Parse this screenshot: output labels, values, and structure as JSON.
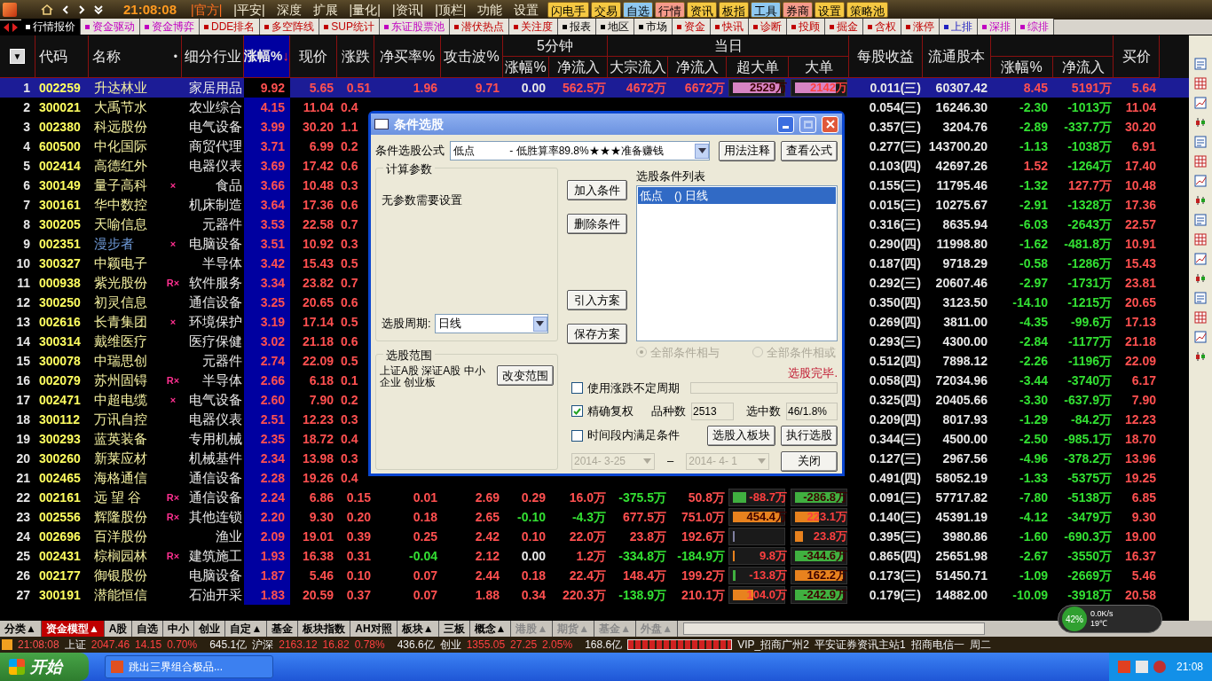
{
  "top_bar": {
    "time": "21:08:08",
    "menus": [
      "|官方|",
      "|平安|",
      "深度",
      "扩展",
      "|量化|",
      "|资讯|",
      "|顶栏|",
      "功能",
      "设置"
    ],
    "buttons": [
      {
        "label": "闪电手",
        "color": "#f5c842"
      },
      {
        "label": "交易",
        "color": "#f5c842"
      },
      {
        "label": "自选",
        "color": "#8ec8f0"
      },
      {
        "label": "行情",
        "color": "#f59a8a"
      },
      {
        "label": "资讯",
        "color": "#f5c842"
      },
      {
        "label": "板指",
        "color": "#f5c842"
      },
      {
        "label": "工具",
        "color": "#8ec8f0"
      },
      {
        "label": "券商",
        "color": "#f59a8a"
      },
      {
        "label": "设置",
        "color": "#f5c842"
      },
      {
        "label": "策略池",
        "color": "#f5c842"
      }
    ]
  },
  "tabs": [
    {
      "label": "行情报价",
      "color": "#ffffff",
      "selected": true
    },
    {
      "label": "资金驱动",
      "color": "#c000c0",
      "selected": false
    },
    {
      "label": "资金博弈",
      "color": "#c000c0",
      "selected": false
    },
    {
      "label": "DDE排名",
      "color": "#c00000",
      "selected": false
    },
    {
      "label": "多空阵线",
      "color": "#c00000",
      "selected": false
    },
    {
      "label": "SUP统计",
      "color": "#c00000",
      "selected": false
    },
    {
      "label": "东证股票池",
      "color": "#c000c0",
      "selected": false
    },
    {
      "label": "潜伏热点",
      "color": "#c00000",
      "selected": false
    },
    {
      "label": "关注度",
      "color": "#c00000",
      "selected": false
    },
    {
      "label": "报表",
      "color": "#000000",
      "selected": false
    },
    {
      "label": "地区",
      "color": "#000000",
      "selected": false
    },
    {
      "label": "市场",
      "color": "#000000",
      "selected": false
    },
    {
      "label": "资金",
      "color": "#c00000",
      "selected": false
    },
    {
      "label": "快讯",
      "color": "#c00000",
      "selected": false
    },
    {
      "label": "诊断",
      "color": "#c00000",
      "selected": false
    },
    {
      "label": "投顾",
      "color": "#c00000",
      "selected": false
    },
    {
      "label": "掘金",
      "color": "#c00000",
      "selected": false
    },
    {
      "label": "含权",
      "color": "#c00000",
      "selected": false
    },
    {
      "label": "涨停",
      "color": "#c00000",
      "selected": false
    },
    {
      "label": "上排",
      "color": "#2020c0",
      "selected": false
    },
    {
      "label": "深排",
      "color": "#c000c0",
      "selected": false
    },
    {
      "label": "综排",
      "color": "#c000c0",
      "selected": false
    }
  ],
  "table": {
    "header": {
      "menu_glyph": "▼",
      "code": "代码",
      "name": "名称",
      "name_mark": "•",
      "industry": "细分行业",
      "change": "涨幅%",
      "sort_glyph": "↓",
      "price": "现价",
      "delta": "涨跌",
      "net_buy": "净买率%",
      "attack": "攻击波%",
      "group_5min": "5分钟",
      "change_5m": "涨幅%",
      "inflow_5m": "净流入",
      "group_today": "当日",
      "block_inflow": "大宗流入",
      "inflow_today": "净流入",
      "super_large": "超大单",
      "large": "大单",
      "eps": "每股收益",
      "float_shares": "流通股本",
      "column_19": "涨幅%",
      "column_20": "净流入",
      "bid": "买价"
    },
    "rows": [
      {
        "no": "1",
        "code": "002259",
        "name": "升达林业",
        "industry": "家居用品",
        "change": "9.92",
        "price": "5.65",
        "delta": "0.51",
        "selected": true,
        "flow": {
          "net_buy": "1.96",
          "attack": "9.71",
          "change_5m": "0.00",
          "inflow_5m": "562.5万",
          "block_inflow": "4672万",
          "inflow_today": "6672万",
          "super_large": {
            "text": "2529万",
            "level": 1,
            "color": "#d884c4"
          },
          "large": {
            "text": "2142万",
            "level": 0.85,
            "color": "#d884c4"
          }
        },
        "eps": "0.011(三)",
        "float_shares": "60307.42",
        "column_19": "8.45",
        "column_20": "5191万",
        "bid": "5.64"
      },
      {
        "no": "2",
        "code": "300021",
        "name": "大禹节水",
        "industry": "农业综合",
        "change": "4.15",
        "price": "11.04",
        "delta": "0.4",
        "selected": false,
        "eps": "0.054(三)",
        "float_shares": "16246.30",
        "column_19": "-2.30",
        "column_20": "-1013万",
        "bid": "11.04"
      },
      {
        "no": "3",
        "code": "002380",
        "name": "科远股份",
        "industry": "电气设备",
        "change": "3.99",
        "price": "30.20",
        "delta": "1.1",
        "selected": false,
        "eps": "0.357(三)",
        "float_shares": "3204.76",
        "column_19": "-2.89",
        "column_20": "-337.7万",
        "bid": "30.20"
      },
      {
        "no": "4",
        "code": "600500",
        "name": "中化国际",
        "industry": "商贸代理",
        "change": "3.71",
        "price": "6.99",
        "delta": "0.2",
        "selected": false,
        "eps": "0.277(三)",
        "float_shares": "143700.20",
        "column_19": "-1.13",
        "column_20": "-1038万",
        "bid": "6.91"
      },
      {
        "no": "5",
        "code": "002414",
        "name": "高德红外",
        "industry": "电器仪表",
        "change": "3.69",
        "price": "17.42",
        "delta": "0.6",
        "selected": false,
        "eps": "0.103(四)",
        "float_shares": "42697.26",
        "column_19": "1.52",
        "column_20": "-1264万",
        "bid": "17.40"
      },
      {
        "no": "6",
        "code": "300149",
        "name": "量子高科",
        "mark": "×",
        "industry": "食品",
        "change": "3.66",
        "price": "10.48",
        "delta": "0.3",
        "selected": false,
        "eps": "0.155(三)",
        "float_shares": "11795.46",
        "column_19": "-1.32",
        "column_20": "127.7万",
        "bid": "10.48"
      },
      {
        "no": "7",
        "code": "300161",
        "name": "华中数控",
        "industry": "机床制造",
        "change": "3.64",
        "price": "17.36",
        "delta": "0.6",
        "selected": false,
        "eps": "0.015(三)",
        "float_shares": "10275.67",
        "column_19": "-2.91",
        "column_20": "-1328万",
        "bid": "17.36"
      },
      {
        "no": "8",
        "code": "300205",
        "name": "天喻信息",
        "industry": "元器件",
        "change": "3.53",
        "price": "22.58",
        "delta": "0.7",
        "selected": false,
        "eps": "0.316(三)",
        "float_shares": "8635.94",
        "column_19": "-6.03",
        "column_20": "-2643万",
        "bid": "22.57"
      },
      {
        "no": "9",
        "code": "002351",
        "name": "漫步者",
        "color": "#6f9ad8",
        "mark": "×",
        "industry": "电脑设备",
        "change": "3.51",
        "price": "10.92",
        "delta": "0.3",
        "selected": false,
        "eps": "0.290(四)",
        "float_shares": "11998.80",
        "column_19": "-1.62",
        "column_20": "-481.8万",
        "bid": "10.91"
      },
      {
        "no": "10",
        "code": "300327",
        "name": "中颖电子",
        "industry": "半导体",
        "change": "3.42",
        "price": "15.43",
        "delta": "0.5",
        "selected": false,
        "eps": "0.187(四)",
        "float_shares": "9718.29",
        "column_19": "-0.58",
        "column_20": "-1286万",
        "bid": "15.43"
      },
      {
        "no": "11",
        "code": "000938",
        "name": "紫光股份",
        "mark": "R×",
        "industry": "软件服务",
        "change": "3.34",
        "price": "23.82",
        "delta": "0.7",
        "selected": false,
        "eps": "0.292(三)",
        "float_shares": "20607.46",
        "column_19": "-2.97",
        "column_20": "-1731万",
        "bid": "23.81"
      },
      {
        "no": "12",
        "code": "300250",
        "name": "初灵信息",
        "industry": "通信设备",
        "change": "3.25",
        "price": "20.65",
        "delta": "0.6",
        "selected": false,
        "eps": "0.350(四)",
        "float_shares": "3123.50",
        "column_19": "-14.10",
        "column_20": "-1215万",
        "bid": "20.65"
      },
      {
        "no": "13",
        "code": "002616",
        "name": "长青集团",
        "mark": "×",
        "industry": "环境保护",
        "change": "3.19",
        "price": "17.14",
        "delta": "0.5",
        "selected": false,
        "eps": "0.269(四)",
        "float_shares": "3811.00",
        "column_19": "-4.35",
        "column_20": "-99.6万",
        "bid": "17.13"
      },
      {
        "no": "14",
        "code": "300314",
        "name": "戴维医疗",
        "industry": "医疗保健",
        "change": "3.02",
        "price": "21.18",
        "delta": "0.6",
        "selected": false,
        "eps": "0.293(三)",
        "float_shares": "4300.00",
        "column_19": "-2.84",
        "column_20": "-1177万",
        "bid": "21.18"
      },
      {
        "no": "15",
        "code": "300078",
        "name": "中瑞思创",
        "industry": "元器件",
        "change": "2.74",
        "price": "22.09",
        "delta": "0.5",
        "selected": false,
        "eps": "0.512(四)",
        "float_shares": "7898.12",
        "column_19": "-2.26",
        "column_20": "-1196万",
        "bid": "22.09"
      },
      {
        "no": "16",
        "code": "002079",
        "name": "苏州固锝",
        "mark": "R×",
        "industry": "半导体",
        "change": "2.66",
        "price": "6.18",
        "delta": "0.1",
        "selected": false,
        "eps": "0.058(四)",
        "float_shares": "72034.96",
        "column_19": "-3.44",
        "column_20": "-3740万",
        "bid": "6.17"
      },
      {
        "no": "17",
        "code": "002471",
        "name": "中超电缆",
        "mark": "×",
        "industry": "电气设备",
        "change": "2.60",
        "price": "7.90",
        "delta": "0.2",
        "selected": false,
        "eps": "0.325(四)",
        "float_shares": "20405.66",
        "column_19": "-3.30",
        "column_20": "-637.9万",
        "bid": "7.90"
      },
      {
        "no": "18",
        "code": "300112",
        "name": "万讯自控",
        "industry": "电器仪表",
        "change": "2.51",
        "price": "12.23",
        "delta": "0.3",
        "selected": false,
        "eps": "0.209(四)",
        "float_shares": "8017.93",
        "column_19": "-1.29",
        "column_20": "-84.2万",
        "bid": "12.23"
      },
      {
        "no": "19",
        "code": "300293",
        "name": "蓝英装备",
        "industry": "专用机械",
        "change": "2.35",
        "price": "18.72",
        "delta": "0.4",
        "selected": false,
        "eps": "0.344(三)",
        "float_shares": "4500.00",
        "column_19": "-2.50",
        "column_20": "-985.1万",
        "bid": "18.70"
      },
      {
        "no": "20",
        "code": "300260",
        "name": "新莱应材",
        "industry": "机械基件",
        "change": "2.34",
        "price": "13.98",
        "delta": "0.3",
        "selected": false,
        "eps": "0.127(三)",
        "float_shares": "2967.56",
        "column_19": "-4.96",
        "column_20": "-378.2万",
        "bid": "13.96"
      },
      {
        "no": "21",
        "code": "002465",
        "name": "海格通信",
        "industry": "通信设备",
        "change": "2.28",
        "price": "19.26",
        "delta": "0.4",
        "selected": false,
        "eps": "0.491(四)",
        "float_shares": "58052.19",
        "column_19": "-1.33",
        "column_20": "-5375万",
        "bid": "19.25"
      },
      {
        "no": "22",
        "code": "002161",
        "name": "远 望 谷",
        "mark": "R×",
        "industry": "通信设备",
        "change": "2.24",
        "price": "6.86",
        "delta": "0.15",
        "selected": false,
        "flow": {
          "net_buy": "0.01",
          "attack": "2.69",
          "change_5m": "0.29",
          "inflow_5m": "16.0万",
          "block_inflow": "-375.5万",
          "inflow_today": "50.8万",
          "super_large": {
            "text": "-88.7万",
            "level": 0.28,
            "color": "#40b040"
          },
          "large": {
            "text": "-286.8万",
            "level": 1,
            "color": "#40b040"
          }
        },
        "eps": "0.091(三)",
        "float_shares": "57717.82",
        "column_19": "-7.80",
        "column_20": "-5138万",
        "bid": "6.85"
      },
      {
        "no": "23",
        "code": "002556",
        "name": "辉隆股份",
        "mark": "R×",
        "industry": "其他连锁",
        "change": "2.20",
        "price": "9.30",
        "delta": "0.20",
        "selected": false,
        "flow": {
          "net_buy": "0.18",
          "attack": "2.65",
          "change_5m": "-0.10",
          "inflow_5m": "-4.3万",
          "block_inflow": "677.5万",
          "inflow_today": "751.0万",
          "super_large": {
            "text": "454.4万",
            "level": 1,
            "color": "#e8821e"
          },
          "large": {
            "text": "223.1万",
            "level": 0.5,
            "color": "#e8821e"
          }
        },
        "eps": "0.140(三)",
        "float_shares": "45391.19",
        "column_19": "-4.12",
        "column_20": "-3479万",
        "bid": "9.30"
      },
      {
        "no": "24",
        "code": "002696",
        "name": "百洋股份",
        "industry": "渔业",
        "change": "2.09",
        "price": "19.01",
        "delta": "0.39",
        "selected": false,
        "flow": {
          "net_buy": "0.25",
          "attack": "2.42",
          "change_5m": "0.10",
          "inflow_5m": "22.0万",
          "block_inflow": "23.8万",
          "inflow_today": "192.6万",
          "super_large": {
            "level": 0.03,
            "color": "#8080a0"
          },
          "large": {
            "text": "23.8万",
            "level": 0.16,
            "color": "#e8821e"
          }
        },
        "eps": "0.395(三)",
        "float_shares": "3980.86",
        "column_19": "-1.60",
        "column_20": "-690.3万",
        "bid": "19.00"
      },
      {
        "no": "25",
        "code": "002431",
        "name": "棕榈园林",
        "mark": "R×",
        "industry": "建筑施工",
        "change": "1.93",
        "price": "16.38",
        "delta": "0.31",
        "selected": false,
        "flow": {
          "net_buy": "-0.04",
          "attack": "2.12",
          "change_5m": "0.00",
          "inflow_5m": "1.2万",
          "block_inflow": "-334.8万",
          "inflow_today": "-184.9万",
          "super_large": {
            "text": "9.8万",
            "level": 0.03,
            "color": "#e8821e"
          },
          "large": {
            "text": "-344.6万",
            "level": 1,
            "color": "#40b040"
          }
        },
        "eps": "0.865(四)",
        "float_shares": "25651.98",
        "column_19": "-2.67",
        "column_20": "-3550万",
        "bid": "16.37"
      },
      {
        "no": "26",
        "code": "002177",
        "name": "御银股份",
        "industry": "电脑设备",
        "change": "1.87",
        "price": "5.46",
        "delta": "0.10",
        "selected": false,
        "flow": {
          "net_buy": "0.07",
          "attack": "2.44",
          "change_5m": "0.18",
          "inflow_5m": "22.4万",
          "block_inflow": "148.4万",
          "inflow_today": "199.2万",
          "super_large": {
            "text": "-13.8万",
            "level": 0.05,
            "color": "#40b040"
          },
          "large": {
            "text": "162.2万",
            "level": 1,
            "color": "#e8821e"
          }
        },
        "eps": "0.173(三)",
        "float_shares": "51450.71",
        "column_19": "-1.09",
        "column_20": "-2669万",
        "bid": "5.46"
      },
      {
        "no": "27",
        "code": "300191",
        "name": "潜能恒信",
        "industry": "石油开采",
        "change": "1.83",
        "price": "20.59",
        "delta": "0.37",
        "selected": false,
        "flow": {
          "net_buy": "0.07",
          "attack": "1.88",
          "change_5m": "0.34",
          "inflow_5m": "220.3万",
          "block_inflow": "-138.9万",
          "inflow_today": "210.1万",
          "super_large": {
            "text": "104.0万",
            "level": 0.42,
            "color": "#e8821e"
          },
          "large": {
            "text": "-242.9万",
            "level": 1,
            "color": "#40b040"
          }
        },
        "eps": "0.179(三)",
        "float_shares": "14882.00",
        "column_19": "-10.09",
        "column_20": "-3918万",
        "bid": "20.58"
      }
    ]
  },
  "dialog": {
    "title": "条件选股",
    "formula_label": "条件选股公式",
    "formula": "低点　　　 - 低胜算率89.8%★★★准备赚钱",
    "usage_button": "用法注释",
    "view_button": "查看公式",
    "params_group": "计算参数",
    "params_text": "无参数需要设置",
    "period_label": "选股周期:",
    "period": "日线",
    "range_group": "选股范围",
    "range_text": "上证A股 深证A股 中小企业 创业板",
    "range_button": "改变范围",
    "actions": [
      "加入条件",
      "删除条件",
      "引入方案",
      "保存方案"
    ],
    "list_label": "选股条件列表",
    "conditions": [
      {
        "label": "低点　() 日线",
        "selected": true
      }
    ],
    "logic": [
      {
        "label": "全部条件相与",
        "selected": true
      },
      {
        "label": "全部条件相或",
        "selected": false
      }
    ],
    "status": "选股完毕.",
    "variable_period": {
      "label": "使用涨跌不定周期",
      "checked": false
    },
    "exact_rights": {
      "label": "精确复权",
      "checked": true
    },
    "count_label": "品种数",
    "count": "2513",
    "picked_label": "选中数",
    "picked": "46/1.8%",
    "time_range": {
      "label": "时间段内满足条件",
      "checked": false
    },
    "to_block_button": "选股入板块",
    "run_button": "执行选股",
    "date_from": "2014- 3-25",
    "date_sep": "–",
    "date_to": "2014- 4- 1",
    "close_button": "关闭"
  },
  "bottom_tabs": [
    {
      "label": "分类▲",
      "selected": false,
      "disabled": false
    },
    {
      "label": "资金模型▲",
      "selected": true,
      "disabled": false
    },
    {
      "label": "A股",
      "selected": false,
      "disabled": false
    },
    {
      "label": "自选",
      "selected": false,
      "disabled": false
    },
    {
      "label": "中小",
      "selected": false,
      "disabled": false
    },
    {
      "label": "创业",
      "selected": false,
      "disabled": false
    },
    {
      "label": "自定▲",
      "selected": false,
      "disabled": false
    },
    {
      "label": "基金",
      "selected": false,
      "disabled": false
    },
    {
      "label": "板块指数",
      "selected": false,
      "disabled": false
    },
    {
      "label": "AH对照",
      "selected": false,
      "disabled": false
    },
    {
      "label": "板块▲",
      "selected": false,
      "disabled": false
    },
    {
      "label": "三板",
      "selected": false,
      "disabled": false
    },
    {
      "label": "概念▲",
      "selected": false,
      "disabled": false
    },
    {
      "label": "港股▲",
      "selected": false,
      "disabled": true
    },
    {
      "label": "期货▲",
      "selected": false,
      "disabled": true
    },
    {
      "label": "基金▲",
      "selected": false,
      "disabled": true
    },
    {
      "label": "外盘▲",
      "selected": false,
      "disabled": true
    }
  ],
  "status_bar": {
    "time": "21:08:08",
    "indices": [
      {
        "name": "上证",
        "value": "2047.46",
        "delta": "14.15",
        "pct": "0.70%",
        "amount": "645.1亿"
      },
      {
        "name": "沪深",
        "value": "2163.12",
        "delta": "16.82",
        "pct": "0.78%",
        "amount": "436.6亿"
      },
      {
        "name": "创业",
        "value": "1355.05",
        "delta": "27.25",
        "pct": "2.05%",
        "amount": "168.6亿"
      }
    ],
    "servers": [
      "VIP_招商广州2",
      "平安证券资讯主站1",
      "招商电信一",
      "周二"
    ]
  },
  "widget": {
    "percent": "42%",
    "speed": "0.0K/s",
    "temperature": "19℃"
  },
  "taskbar": {
    "start": "开始",
    "task": "跳出三界组合极品...",
    "clock": "21:08"
  }
}
